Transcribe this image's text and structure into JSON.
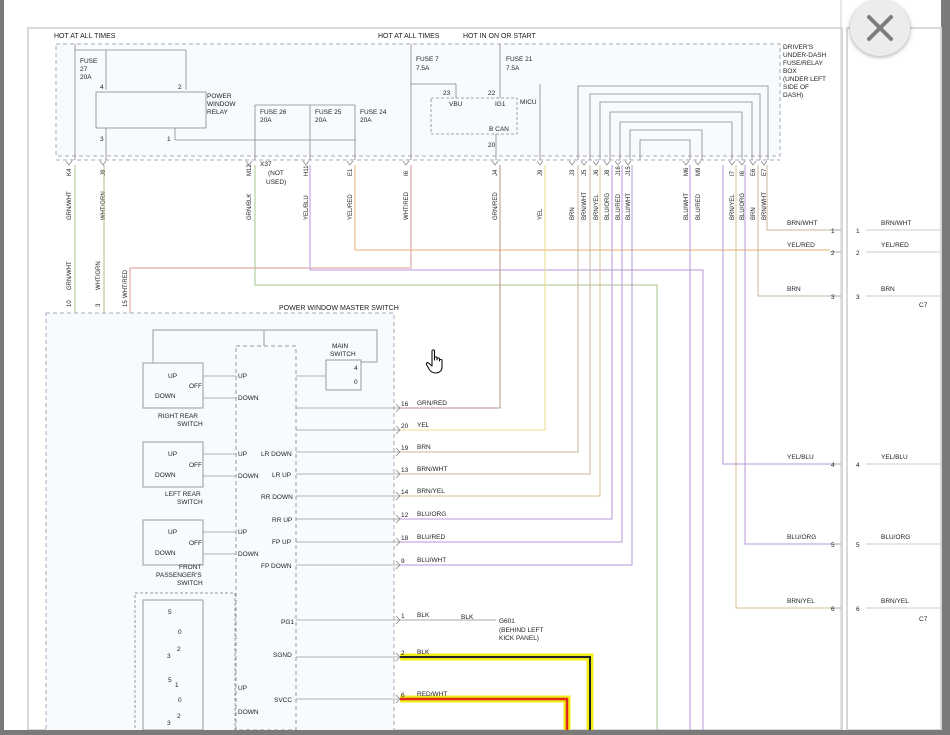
{
  "top_labels": {
    "hot1": "HOT AT ALL TIMES",
    "hot2": "HOT AT ALL TIMES",
    "hot_run": "HOT IN ON OR START"
  },
  "fuse_box": {
    "title_lines": [
      "DRIVER'S",
      "UNDER-DASH",
      "FUSE/RELAY",
      "BOX",
      "(UNDER LEFT",
      "SIDE OF",
      "DASH)"
    ]
  },
  "fuses": {
    "f27": [
      "FUSE",
      "27",
      "20A"
    ],
    "f26": [
      "FUSE 26",
      "20A"
    ],
    "f25": [
      "FUSE 25",
      "20A"
    ],
    "f24": [
      "FUSE 24",
      "20A"
    ],
    "f7": [
      "FUSE 7",
      "7.5A"
    ],
    "f21": [
      "FUSE 21",
      "7.5A"
    ]
  },
  "relay": {
    "label_lines": [
      "POWER",
      "WINDOW",
      "RELAY"
    ],
    "pins": [
      "4",
      "2",
      "3",
      "1"
    ]
  },
  "micu": {
    "label": "MICU",
    "vbu": "VBU",
    "ig1": "IG1",
    "bcan": "B CAN",
    "pins": [
      "23",
      "22",
      "20"
    ]
  },
  "x37": [
    "X37",
    "(NOT",
    "USED)"
  ],
  "conn_top": [
    "K4",
    "J8",
    "M12",
    "H11",
    "E1",
    "I6",
    "J4",
    "J9",
    "J3",
    "J5",
    "J6",
    "J8",
    "J16",
    "J15",
    "M6",
    "M9",
    "I7",
    "I6",
    "E6",
    "E7",
    "E11"
  ],
  "wires_top": [
    "GRN/WHT",
    "WHT/GRN",
    "GRN/BLK",
    "YEL/BLU",
    "YEL/RED",
    "WHT/RED",
    "GRN/RED",
    "YEL",
    "BRN",
    "BRN/WHT",
    "BRN/YEL",
    "BLU/ORG",
    "BLU/RED",
    "BLU/WHT",
    "BLU/WHT",
    "BLU/RED",
    "BRN/YEL",
    "BLU/ORG",
    "BRN",
    "BRN/WHT"
  ],
  "left_wires": {
    "w1": "GRN/WHT",
    "w2": "WHT/GRN",
    "w3": "WHT/RED",
    "p1": "10",
    "p2": "3",
    "p3": "15"
  },
  "master": {
    "title": "POWER WINDOW MASTER SWITCH",
    "main_switch": [
      "MAIN",
      "SWITCH"
    ],
    "main_pins": [
      "4",
      "0"
    ],
    "right_rear": [
      "RIGHT REAR",
      "SWITCH"
    ],
    "left_rear": [
      "LEFT REAR",
      "SWITCH"
    ],
    "front_pass": [
      "FRONT",
      "PASSENGER'S",
      "SWITCH"
    ],
    "up": "UP",
    "down": "DOWN",
    "off": "OFF",
    "pos": [
      "5",
      "0",
      "2",
      "3",
      "5",
      "1",
      "0",
      "2",
      "3",
      "1"
    ],
    "funcs": [
      "UP",
      "DOWN",
      "LR DOWN",
      "LR UP",
      "RR DOWN",
      "RR UP",
      "FP UP",
      "FP DOWN",
      "UP",
      "DOWN",
      "UP",
      "DOWN",
      "PG1",
      "SGND",
      "SVCC"
    ]
  },
  "pins": [
    {
      "n": "16",
      "w": "GRN/RED"
    },
    {
      "n": "20",
      "w": "YEL"
    },
    {
      "n": "19",
      "w": "BRN"
    },
    {
      "n": "13",
      "w": "BRN/WHT"
    },
    {
      "n": "14",
      "w": "BRN/YEL"
    },
    {
      "n": "12",
      "w": "BLU/ORG"
    },
    {
      "n": "18",
      "w": "BLU/RED"
    },
    {
      "n": "9",
      "w": "BLU/WHT"
    },
    {
      "n": "1",
      "w": "BLK"
    },
    {
      "n": "2",
      "w": "BLK"
    },
    {
      "n": "6",
      "w": "RED/WHT"
    }
  ],
  "ground": {
    "wire": "BLK",
    "name": "G601",
    "loc": [
      "(BEHIND LEFT",
      "KICK PANEL)"
    ]
  },
  "right_conn": [
    {
      "w": "BRN/WHT",
      "n": "1"
    },
    {
      "w": "YEL/RED",
      "n": "2"
    },
    {
      "w": "BRN",
      "n": "3"
    },
    {
      "w": "YEL/BLU",
      "n": "4"
    },
    {
      "w": "BLU/ORG",
      "n": "5"
    },
    {
      "w": "BRN/YEL",
      "n": "6"
    }
  ],
  "next_page": {
    "c1": "C7",
    "c2": "C7"
  },
  "colors": {
    "grn_red": "#b89088",
    "yel": "#e8dc8a",
    "brn": "#c4b49a",
    "brn_yel": "#d9c287",
    "blu": "#b496d8",
    "grn": "#a6c48c",
    "blk_highlight": "#f2ec1a",
    "red": "#e12a1a"
  },
  "icons": {
    "close": "close-icon",
    "cursor": "hand-pointer-icon"
  }
}
